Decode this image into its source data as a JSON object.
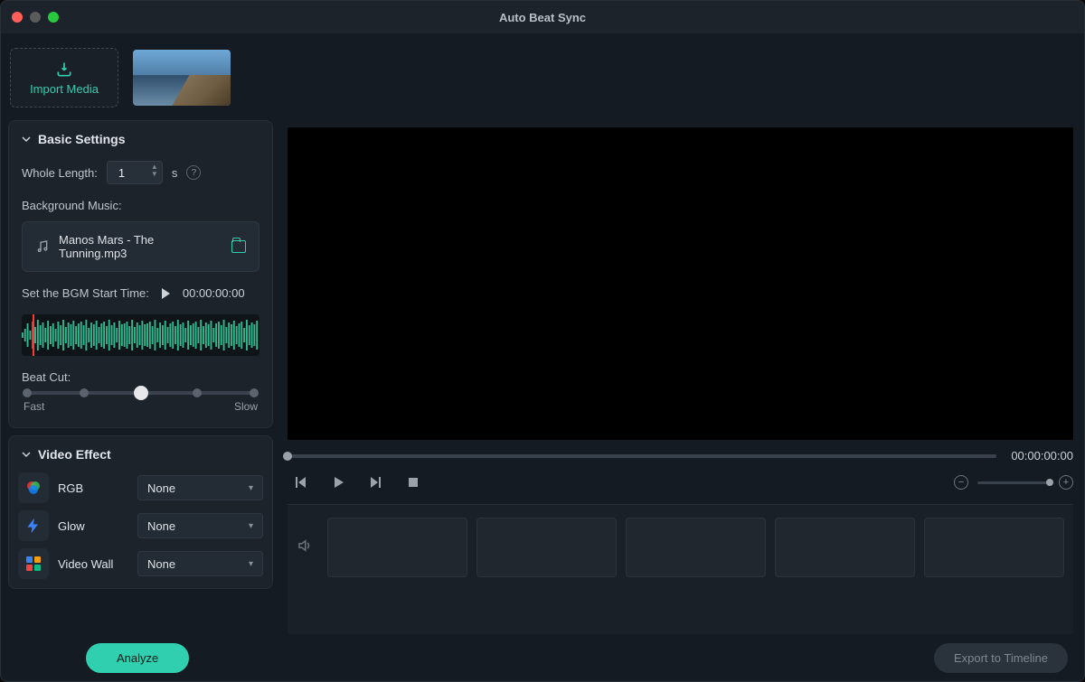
{
  "titlebar": {
    "title": "Auto Beat Sync"
  },
  "media": {
    "import_label": "Import Media"
  },
  "basic": {
    "heading": "Basic Settings",
    "whole_length_label": "Whole Length:",
    "whole_length_value": "1",
    "whole_length_unit": "s",
    "bg_music_label": "Background Music:",
    "bg_music_file": "Manos Mars - The Tunning.mp3",
    "bgm_start_label": "Set the BGM Start Time:",
    "bgm_start_time": "00:00:00:00",
    "beat_cut_label": "Beat Cut:",
    "beat_cut_fast": "Fast",
    "beat_cut_slow": "Slow"
  },
  "video_effect": {
    "heading": "Video Effect",
    "rows": [
      {
        "name": "RGB",
        "value": "None"
      },
      {
        "name": "Glow",
        "value": "None"
      },
      {
        "name": "Video Wall",
        "value": "None"
      }
    ]
  },
  "preview": {
    "timecode": "00:00:00:00"
  },
  "footer": {
    "analyze": "Analyze",
    "export": "Export to Timeline"
  },
  "colors": {
    "accent": "#2fcfb0"
  }
}
